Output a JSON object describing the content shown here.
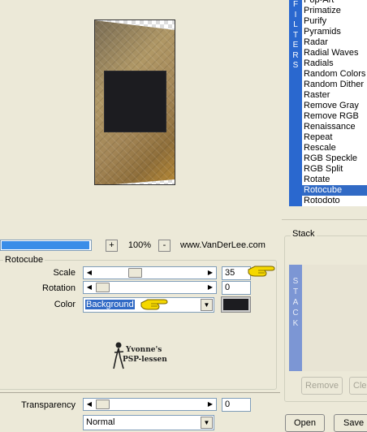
{
  "preview": {},
  "zoom": {
    "minus_label": "+",
    "value": "100%",
    "plus_label": "-",
    "progress": 0.97
  },
  "credit": "www.VanDerLee.com",
  "group_title": "Rotocube",
  "params": {
    "scale": {
      "label": "Scale",
      "value": "35"
    },
    "rotation": {
      "label": "Rotation",
      "value": "0"
    },
    "color": {
      "label": "Color",
      "selected": "Background",
      "swatch": "#1c1c20"
    }
  },
  "logo": {
    "line1": "Yvonne's",
    "line2": "PSP-lessen"
  },
  "transparency": {
    "label": "Transparency",
    "value": "0"
  },
  "blend_mode": {
    "selected": "Normal"
  },
  "filters": {
    "side_label": "FILTERS",
    "items": [
      "Pop-Art",
      "Primatize",
      "Purify",
      "Pyramids",
      "Radar",
      "Radial Waves",
      "Radials",
      "Random Colors",
      "Random Dither",
      "Raster",
      "Remove Gray",
      "Remove RGB",
      "Renaissance",
      "Repeat",
      "Rescale",
      "RGB Speckle",
      "RGB Split",
      "Rotate",
      "Rotocube",
      "Rotodoto"
    ],
    "selected": "Rotocube",
    "accent": "#316ac5"
  },
  "stack": {
    "title": "Stack",
    "side_label": "STACK",
    "remove_label": "Remove",
    "clear_label": "Clear"
  },
  "buttons": {
    "open": "Open",
    "save": "Save"
  }
}
